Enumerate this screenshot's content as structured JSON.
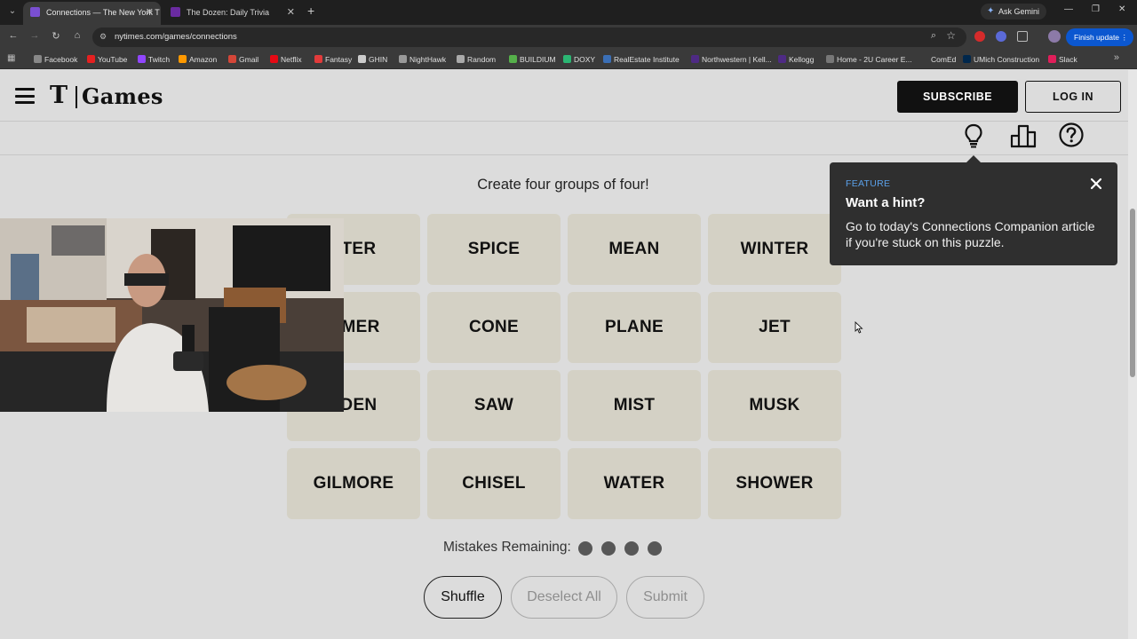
{
  "browser": {
    "tabs": [
      {
        "title": "Connections — The New York T",
        "active": true,
        "favicon_color": "#7a4fd1"
      },
      {
        "title": "The Dozen: Daily Trivia",
        "active": false,
        "favicon_color": "#6a2ba0"
      }
    ],
    "ask_gemini": "Ask Gemini",
    "url": "nytimes.com/games/connections",
    "finish_update": "Finish update",
    "bookmarks": [
      {
        "label": "Facebook",
        "color": "#888"
      },
      {
        "label": "YouTube",
        "color": "#e52020"
      },
      {
        "label": "Twitch",
        "color": "#9146ff"
      },
      {
        "label": "Amazon",
        "color": "#ff9900"
      },
      {
        "label": "Gmail",
        "color": "#d44638"
      },
      {
        "label": "Netflix",
        "color": "#e50914"
      },
      {
        "label": "Fantasy",
        "color": "#e23b3b"
      },
      {
        "label": "GHIN",
        "color": "#cccccc"
      },
      {
        "label": "NightHawk",
        "color": "#999999"
      },
      {
        "label": "Random",
        "color": "#aaaaaa"
      },
      {
        "label": "BUILDIUM",
        "color": "#55b04a"
      },
      {
        "label": "DOXY",
        "color": "#2bb673"
      },
      {
        "label": "RealEstate Institute",
        "color": "#3b6fb6"
      },
      {
        "label": "Northwestern | Kell...",
        "color": "#4e2a84"
      },
      {
        "label": "Kellogg",
        "color": "#4e2a84"
      },
      {
        "label": "Home - 2U Career E...",
        "color": "#777777"
      },
      {
        "label": "ComEd",
        "color": "#3a3a3a"
      },
      {
        "label": "UMich Construction",
        "color": "#00274c"
      },
      {
        "label": "Slack",
        "color": "#e01e5a"
      }
    ]
  },
  "header": {
    "logo_mark": "T",
    "logo_text": "Games",
    "subscribe_label": "SUBSCRIBE",
    "login_label": "LOG IN"
  },
  "game": {
    "prompt": "Create four groups of four!",
    "tiles": [
      [
        "TTER",
        "SPICE",
        "MEAN",
        "WINTER"
      ],
      [
        "MMER",
        "CONE",
        "PLANE",
        "JET"
      ],
      [
        "LDEN",
        "SAW",
        "MIST",
        "MUSK"
      ],
      [
        "GILMORE",
        "CHISEL",
        "WATER",
        "SHOWER"
      ]
    ],
    "mistakes_label": "Mistakes Remaining:",
    "mistakes_remaining": 4,
    "buttons": {
      "shuffle": "Shuffle",
      "deselect": "Deselect All",
      "submit": "Submit"
    }
  },
  "tooltip": {
    "kicker": "FEATURE",
    "title": "Want a hint?",
    "body": "Go to today's Connections Companion article if you're stuck on this puzzle."
  },
  "icons": [
    "menu-icon",
    "hint-lightbulb-icon",
    "leaderboard-icon",
    "help-icon",
    "close-icon"
  ]
}
